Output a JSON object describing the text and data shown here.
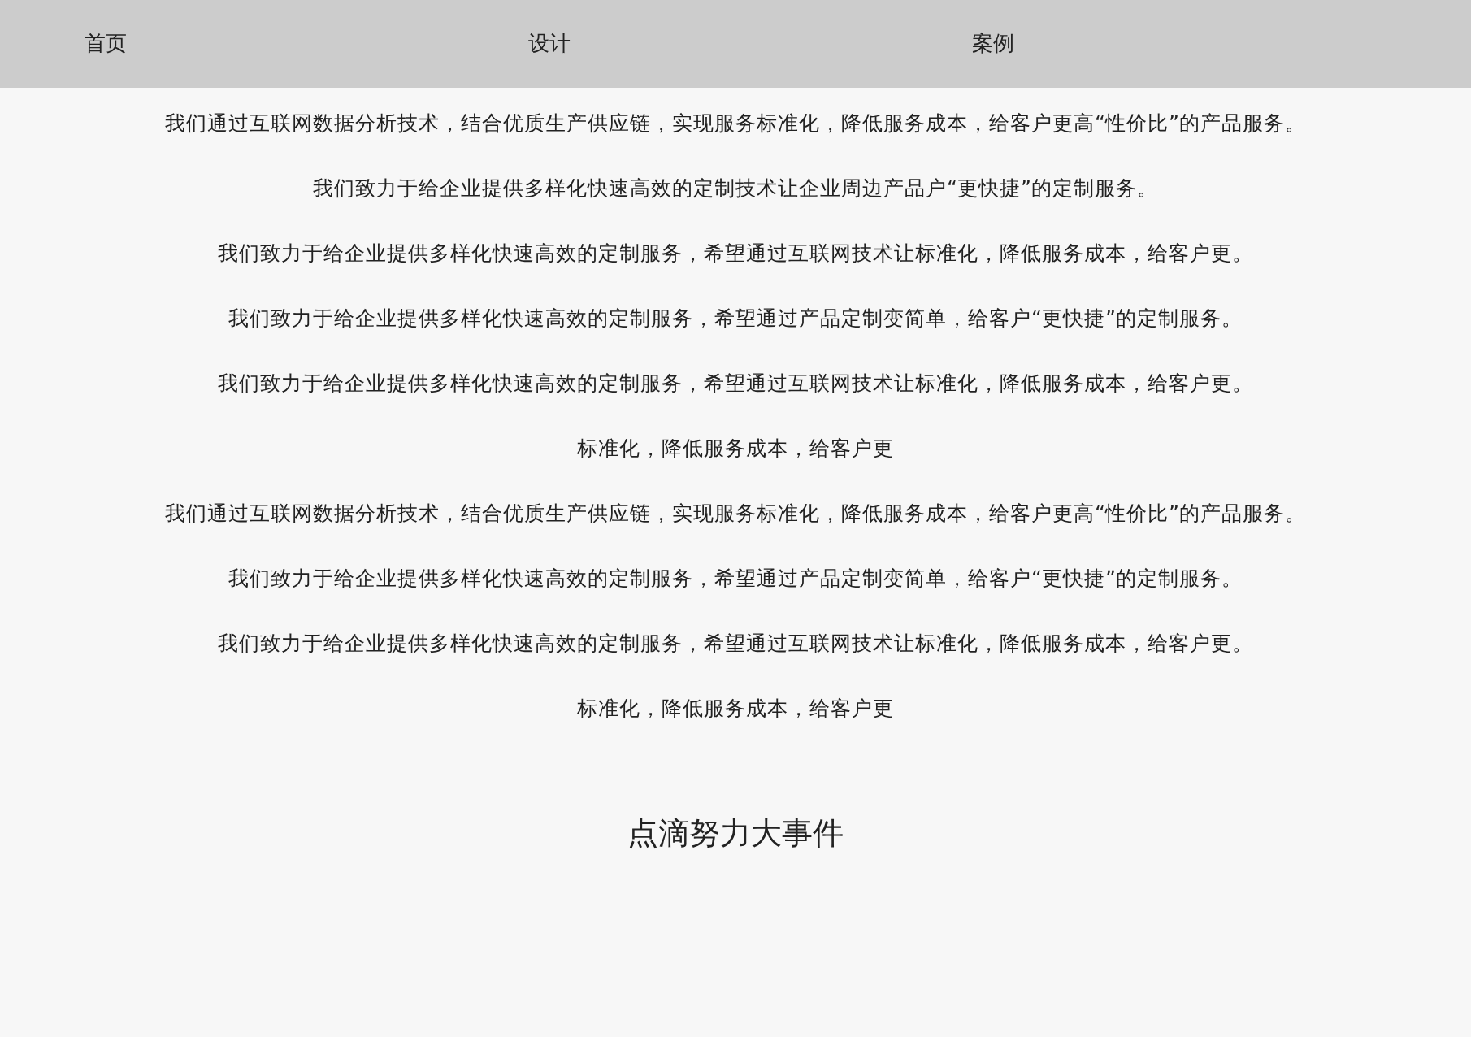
{
  "nav": {
    "items": [
      {
        "label": "首页"
      },
      {
        "label": "设计"
      },
      {
        "label": "案例"
      }
    ]
  },
  "paragraphs": [
    "我们通过互联网数据分析技术，结合优质生产供应链，实现服务标准化，降低服务成本，给客户更高“性价比”的产品服务。",
    "我们致力于给企业提供多样化快速高效的定制技术让企业周边产品户“更快捷”的定制服务。",
    "我们致力于给企业提供多样化快速高效的定制服务，希望通过互联网技术让标准化，降低服务成本，给客户更。",
    "我们致力于给企业提供多样化快速高效的定制服务，希望通过产品定制变简单，给客户“更快捷”的定制服务。",
    "我们致力于给企业提供多样化快速高效的定制服务，希望通过互联网技术让标准化，降低服务成本，给客户更。",
    "标准化，降低服务成本，给客户更",
    "我们通过互联网数据分析技术，结合优质生产供应链，实现服务标准化，降低服务成本，给客户更高“性价比”的产品服务。",
    "我们致力于给企业提供多样化快速高效的定制服务，希望通过产品定制变简单，给客户“更快捷”的定制服务。",
    "我们致力于给企业提供多样化快速高效的定制服务，希望通过互联网技术让标准化，降低服务成本，给客户更。",
    "标准化，降低服务成本，给客户更"
  ],
  "heading": "点滴努力大事件"
}
